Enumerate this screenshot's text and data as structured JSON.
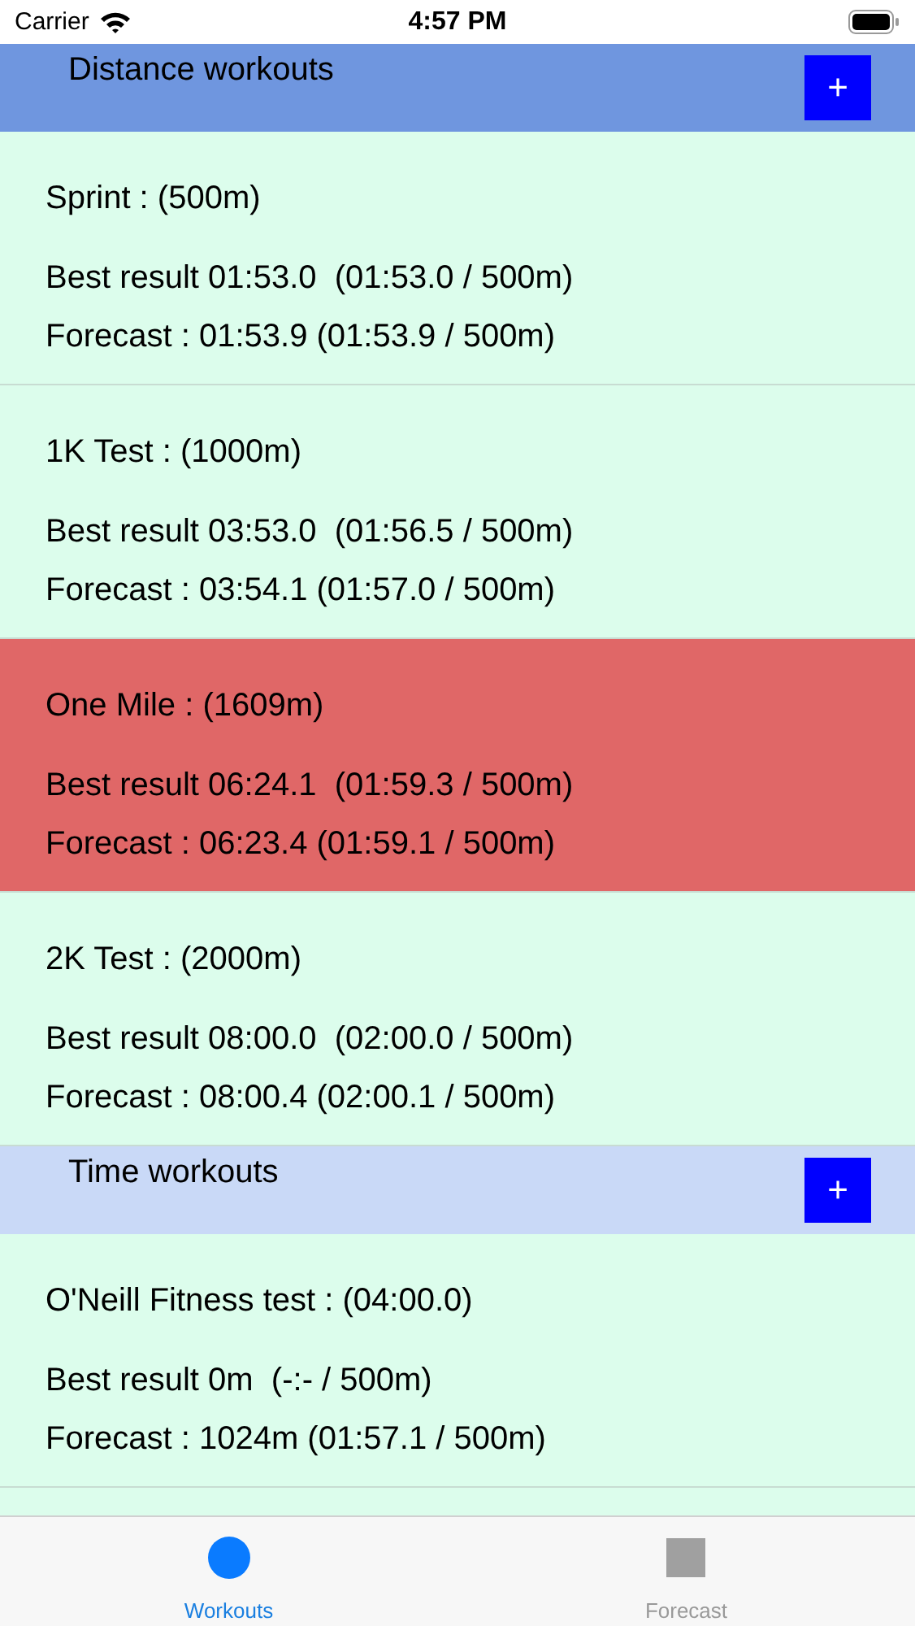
{
  "status_bar": {
    "carrier": "Carrier",
    "time": "4:57 PM"
  },
  "sections": [
    {
      "title": "Distance workouts",
      "color": "#6f96df",
      "add_button": "+",
      "rows": [
        {
          "title": "Sprint : (500m)",
          "best": "Best result 01:53.0  (01:53.0 / 500m)",
          "forecast": "Forecast : 01:53.9 (01:53.9 / 500m)",
          "highlighted": false
        },
        {
          "title": "1K Test : (1000m)",
          "best": "Best result 03:53.0  (01:56.5 / 500m)",
          "forecast": "Forecast : 03:54.1 (01:57.0 / 500m)",
          "highlighted": false
        },
        {
          "title": "One Mile : (1609m)",
          "best": "Best result 06:24.1  (01:59.3 / 500m)",
          "forecast": "Forecast : 06:23.4 (01:59.1 / 500m)",
          "highlighted": true
        },
        {
          "title": "2K Test : (2000m)",
          "best": "Best result 08:00.0  (02:00.0 / 500m)",
          "forecast": "Forecast : 08:00.4 (02:00.1 / 500m)",
          "highlighted": false
        }
      ]
    },
    {
      "title": "Time workouts",
      "color": "#c9d9f7",
      "add_button": "+",
      "rows": [
        {
          "title": "O'Neill Fitness test : (04:00.0)",
          "best": "Best result 0m  (-:- / 500m)",
          "forecast": "Forecast : 1024m (01:57.1 / 500m)",
          "highlighted": false
        }
      ]
    }
  ],
  "tabs": [
    {
      "label": "Workouts",
      "kind": "circle",
      "selected": true
    },
    {
      "label": "Forecast",
      "kind": "square",
      "selected": false
    }
  ]
}
